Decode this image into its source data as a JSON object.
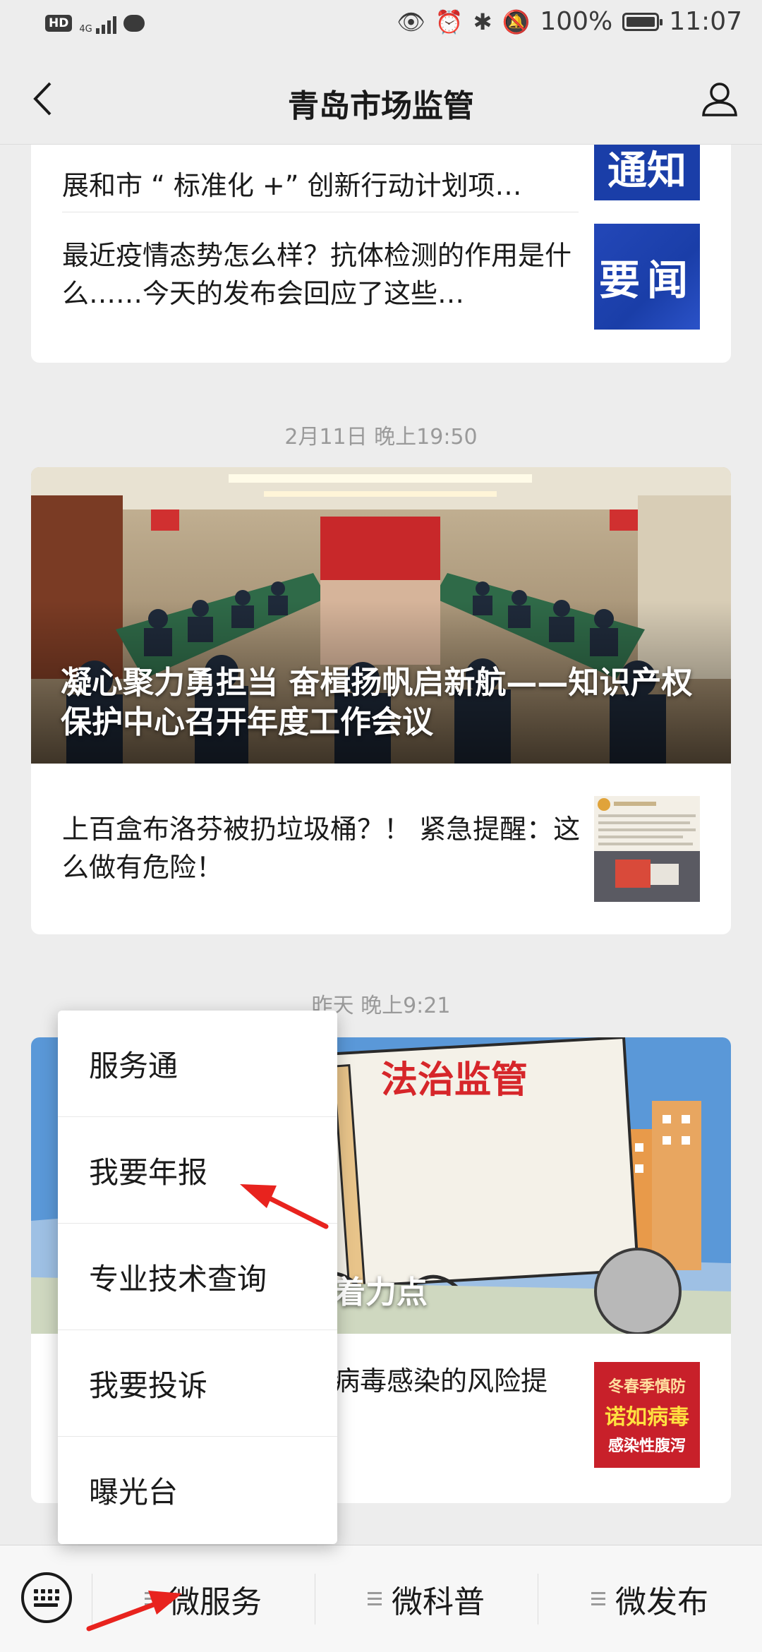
{
  "status_bar": {
    "hd_badge": "HD",
    "network": "4G",
    "battery_text": "100%",
    "battery_level": 1.0,
    "time": "11:07"
  },
  "nav": {
    "title": "青岛市场监管",
    "back_icon": "chevron-left-icon",
    "user_icon": "person-icon"
  },
  "feed": {
    "group1": {
      "items": [
        {
          "title": "展和市 “ 标准化 +” 创新行动计划项…",
          "thumb_text": "通知"
        },
        {
          "title": "最近疫情态势怎么样？抗体检测的作用是什么……今天的发布会回应了这些…",
          "thumb_text": "要闻"
        }
      ]
    },
    "group2": {
      "time": "2月11日 晚上19:50",
      "hero_title": "凝心聚力勇担当 奋楫扬帆启新航——知识产权保护中心召开年度工作会议",
      "items": [
        {
          "title": "上百盒布洛芬被扔垃圾桶？！ 紧急提醒：这么做有危险！"
        }
      ]
    },
    "group3": {
      "time": "昨天 晚上9:21",
      "hero_sign": "法治监管",
      "hero_title": "着力点",
      "items": [
        {
          "title": "病毒感染的风险提",
          "thumb_line1": "冬春季慎防",
          "thumb_line2": "诺如病毒",
          "thumb_line3": "感染性腹泻"
        }
      ]
    }
  },
  "popup_menu": {
    "items": [
      "服务通",
      "我要年报",
      "专业技术查询",
      "我要投诉",
      "曝光台"
    ]
  },
  "bottom_menu": {
    "keyboard_icon": "keyboard-icon",
    "tabs": [
      "微服务",
      "微科普",
      "微发布"
    ]
  },
  "colors": {
    "annotation_arrow": "#e8231e",
    "thumb_blue": "#1a3ea8"
  }
}
